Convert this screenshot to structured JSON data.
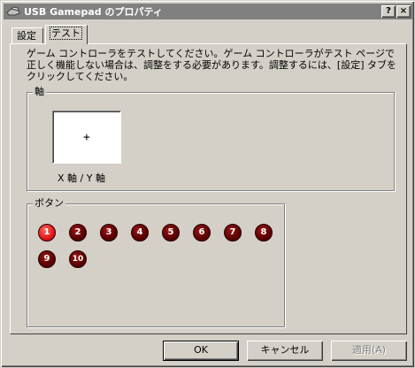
{
  "window": {
    "title": "USB Gamepad のプロパティ",
    "help_label": "?",
    "close_label": "×"
  },
  "tabs": [
    {
      "label": "設定",
      "active": false
    },
    {
      "label": "テスト",
      "active": true
    }
  ],
  "test_panel": {
    "instructions": "ゲーム コントローラをテストしてください。ゲーム コントローラがテスト ページで正しく機能しない場合は、調整をする必要があります。調整するには、[設定] タブをクリックしてください。",
    "axes_group": {
      "label": "軸",
      "crosshair": "+",
      "caption": "X 軸 / Y 軸"
    },
    "buttons_group": {
      "label": "ボタン",
      "buttons": [
        {
          "number": "1",
          "pressed": true
        },
        {
          "number": "2",
          "pressed": false
        },
        {
          "number": "3",
          "pressed": false
        },
        {
          "number": "4",
          "pressed": false
        },
        {
          "number": "5",
          "pressed": false
        },
        {
          "number": "6",
          "pressed": false
        },
        {
          "number": "7",
          "pressed": false
        },
        {
          "number": "8",
          "pressed": false
        },
        {
          "number": "9",
          "pressed": false
        },
        {
          "number": "10",
          "pressed": false
        }
      ]
    }
  },
  "dialog_buttons": {
    "ok": "OK",
    "cancel": "キャンセル",
    "apply": "適用(A)"
  },
  "colors": {
    "titlebar_inactive": "#808080",
    "face": "#d4d0c8",
    "button_active": "#e41b1b",
    "button_idle": "#5a0000"
  }
}
